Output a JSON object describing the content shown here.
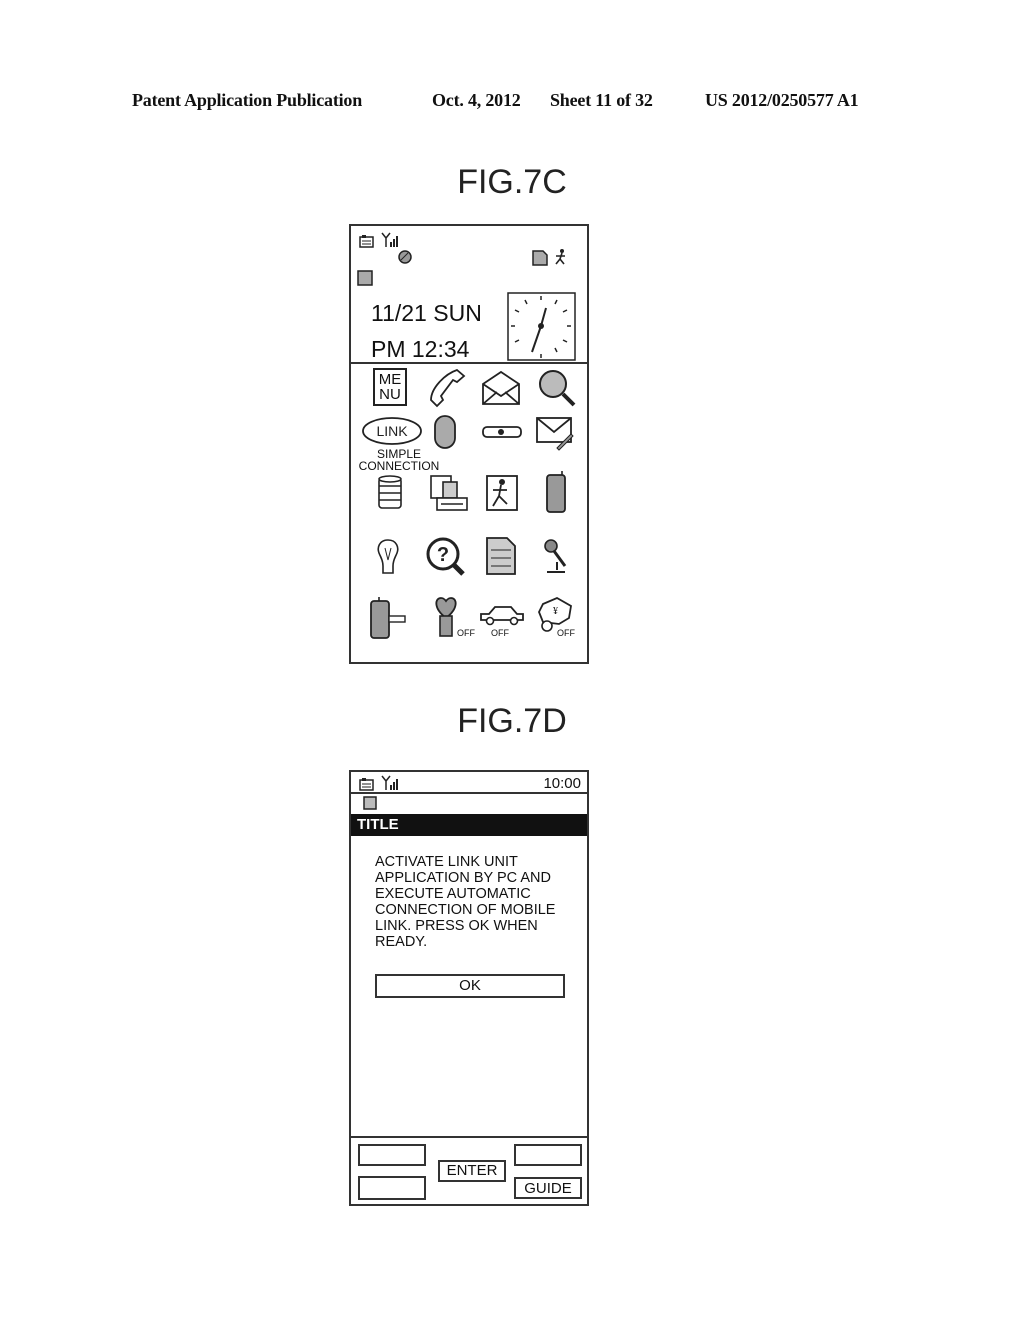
{
  "header": {
    "publication": "Patent Application Publication",
    "date": "Oct. 4, 2012",
    "sheet": "Sheet 11 of 32",
    "number": "US 2012/0250577 A1"
  },
  "fig7c": {
    "title": "FIG.7C",
    "status_icons": [
      "battery-icon",
      "signal-antenna-icon",
      "globe-icon",
      "memo-icon",
      "walking-person-icon",
      "mail-indicator-icon"
    ],
    "date": "11/21 SUN",
    "time": "PM 12:34",
    "clock_icon": "analog-clock-icon",
    "menu_icons": [
      {
        "name": "menu-icon",
        "text": "ME NU"
      },
      {
        "name": "phone-icon"
      },
      {
        "name": "open-envelope-icon"
      },
      {
        "name": "magnifier-icon"
      },
      {
        "name": "link-icon",
        "text": "LINK",
        "label": "SIMPLE CONNECTION"
      },
      {
        "name": "capsule-icon"
      },
      {
        "name": "key-icon"
      },
      {
        "name": "mail-edit-icon"
      },
      {
        "name": "database-icon"
      },
      {
        "name": "printer-icon"
      },
      {
        "name": "running-person-icon"
      },
      {
        "name": "mobile-phone-icon"
      },
      {
        "name": "light-bulb-icon"
      },
      {
        "name": "help-magnifier-icon"
      },
      {
        "name": "document-icon"
      },
      {
        "name": "microphone-icon"
      },
      {
        "name": "phone-key-icon"
      },
      {
        "name": "heart-key-icon",
        "badge": "OFF"
      },
      {
        "name": "car-icon",
        "badge": "OFF"
      },
      {
        "name": "wallet-icon",
        "badge": "OFF"
      }
    ]
  },
  "fig7d": {
    "title": "FIG.7D",
    "clock": "10:00",
    "title_bar": "TITLE",
    "message_lines": [
      "ACTIVATE LINK UNIT",
      "APPLICATION BY PC AND",
      "EXECUTE AUTOMATIC",
      "CONNECTION OF MOBILE",
      "LINK.  PRESS OK WHEN",
      "READY."
    ],
    "ok_label": "OK",
    "softkeys": {
      "enter": "ENTER",
      "guide": "GUIDE"
    }
  }
}
